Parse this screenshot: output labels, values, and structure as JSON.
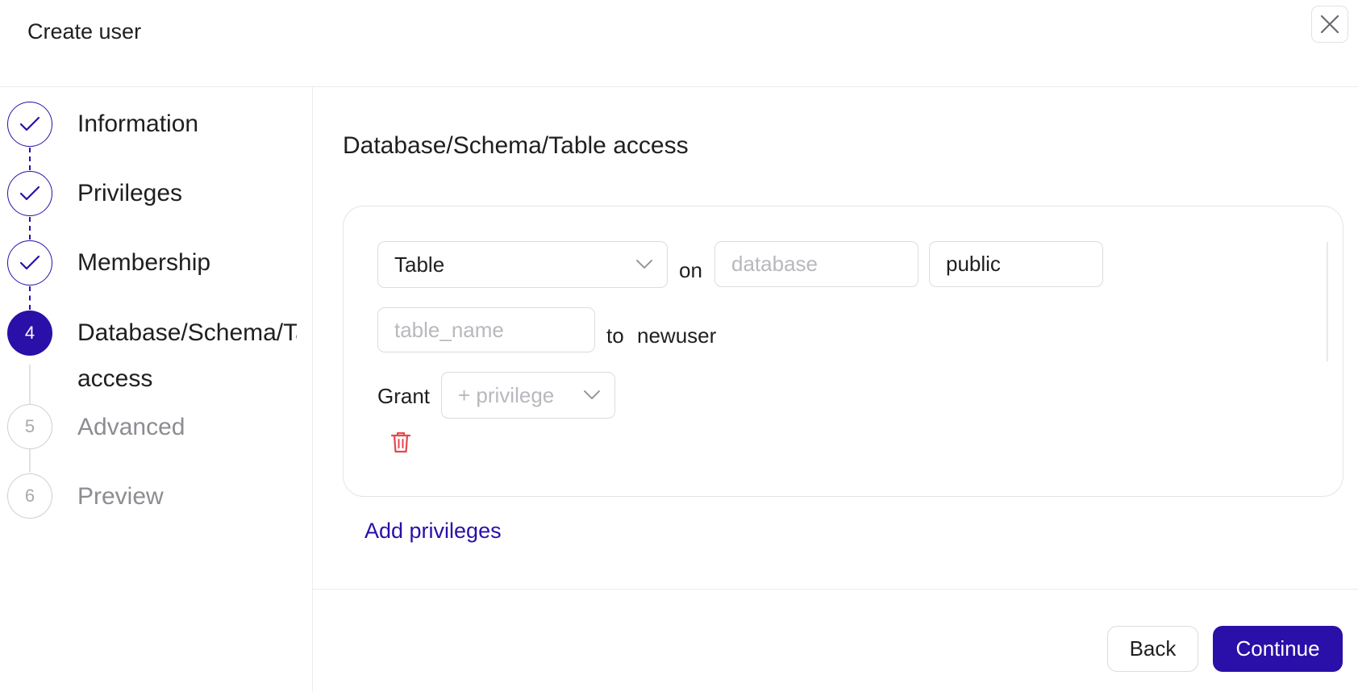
{
  "dialog": {
    "title": "Create user"
  },
  "steps": [
    {
      "label": "Information",
      "marker": "",
      "state": "done"
    },
    {
      "label": "Privileges",
      "marker": "",
      "state": "done"
    },
    {
      "label": "Membership",
      "marker": "",
      "state": "done"
    },
    {
      "label": "Database/Schema/Table access",
      "marker": "4",
      "state": "active"
    },
    {
      "label": "Advanced",
      "marker": "5",
      "state": "pending"
    },
    {
      "label": "Preview",
      "marker": "6",
      "state": "pending"
    }
  ],
  "main": {
    "section_title": "Database/Schema/Table access",
    "rule": {
      "object_type": "Table",
      "on_label": "on",
      "database_placeholder": "database",
      "schema_value": "public",
      "table_placeholder": "table_name",
      "to_label": "to",
      "username": "newuser",
      "grant_label": "Grant",
      "privilege_placeholder": "+ privilege"
    },
    "add_link": "Add privileges"
  },
  "footer": {
    "back_label": "Back",
    "continue_label": "Continue"
  },
  "icons": {
    "close": "close-icon",
    "step_done": "check-icon",
    "dropdown": "chevron-down-icon",
    "delete": "trash-icon"
  },
  "colors": {
    "accent": "#2a0fa8",
    "danger": "#e5484d",
    "border": "#dcdce0",
    "muted_text": "#8c8c92"
  }
}
